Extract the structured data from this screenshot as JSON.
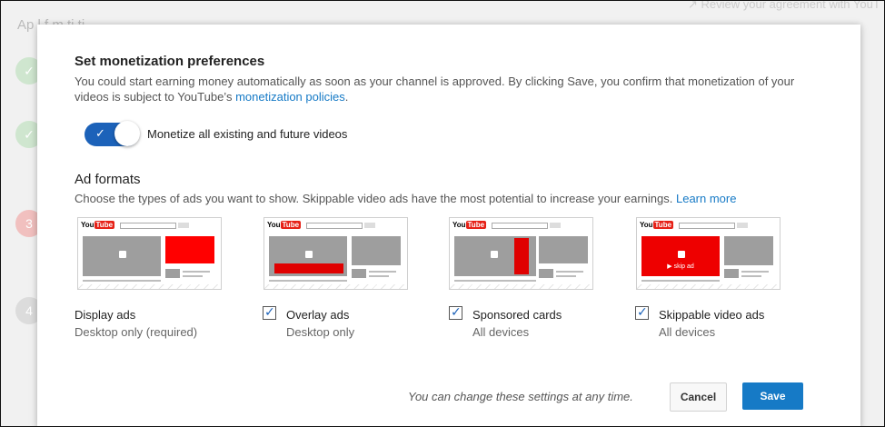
{
  "background": {
    "title": "Ap  l  f  m     ti  ti",
    "link": "↗ Review your agreement with YouT",
    "steps": [
      "✓",
      "✓",
      "3",
      "4"
    ]
  },
  "dialog": {
    "section1_title": "Set monetization preferences",
    "section1_desc": "You could start earning money automatically as soon as your channel is approved. By clicking Save, you confirm that monetization of your videos is subject to YouTube’s",
    "section1_link": "monetization policies",
    "section1_period": ".",
    "toggle_label": "Monetize all existing and future videos",
    "toggle_on": true,
    "section2_title": "Ad formats",
    "section2_desc": "Choose the types of ads you want to show. Skippable video ads have the most potential to increase your earnings.",
    "section2_link": "Learn more",
    "thumb_logo_you": "You",
    "thumb_logo_tube": "Tube",
    "skip_ad_label": "▶ skip ad",
    "ads": [
      {
        "title": "Display ads",
        "subtitle": "Desktop only (required)",
        "checkbox": false
      },
      {
        "title": "Overlay ads",
        "subtitle": "Desktop only",
        "checkbox": true,
        "checked": true
      },
      {
        "title": "Sponsored cards",
        "subtitle": "All devices",
        "checkbox": true,
        "checked": true
      },
      {
        "title": "Skippable video ads",
        "subtitle": "All devices",
        "checkbox": true,
        "checked": true
      }
    ],
    "footer_note": "You can change these settings at any time.",
    "cancel_label": "Cancel",
    "save_label": "Save"
  },
  "colors": {
    "accent": "#167ac6",
    "toggle": "#1c62b9",
    "ad_red": "#ff0000"
  }
}
